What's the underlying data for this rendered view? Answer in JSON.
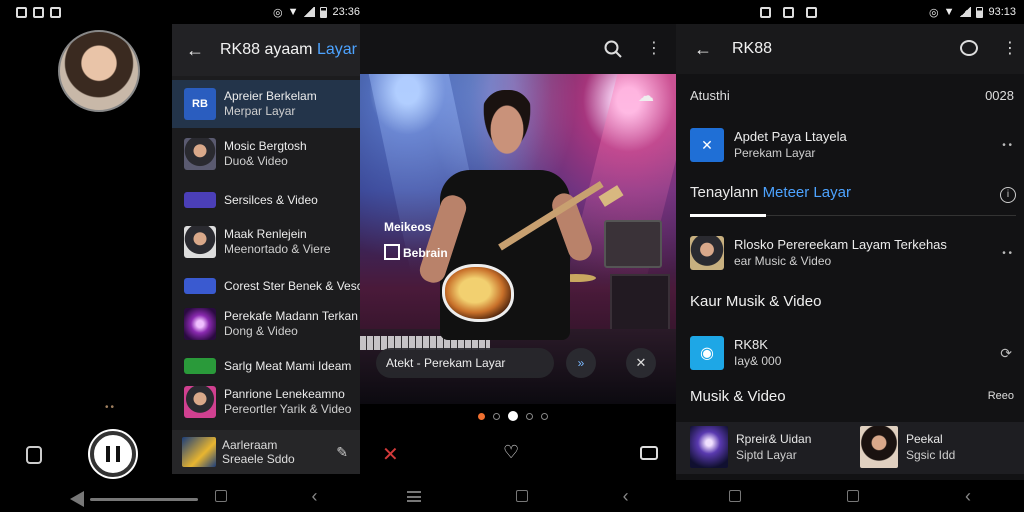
{
  "status_left": {
    "time": ""
  },
  "status_mid": {
    "time": "23:36"
  },
  "status_right": {
    "time": "93:13"
  },
  "menu": {
    "title_main": "RK88 ayaam",
    "title_accent": "Layar",
    "items": [
      {
        "line1": "Apreier Berkelam",
        "line2": "Merpar Layar"
      },
      {
        "line1": "Mosic Bergtosh",
        "line2": "Duo& Video"
      },
      {
        "line1": "Sersilces & Video",
        "line2": ""
      },
      {
        "line1": "Maak Renlejein",
        "line2": "Meenortado & Viere"
      },
      {
        "line1": "Corest Ster Benek & Veso",
        "line2": ""
      },
      {
        "line1": "Perekafe Madann Terkan",
        "line2": "Dong & Video"
      },
      {
        "line1": "Sarlg Meat Mami Ideam",
        "line2": ""
      },
      {
        "line1": "Panrione Lenekeamno",
        "line2": "Pereortler Yarik & Video"
      }
    ],
    "bottom": {
      "line1": "Aarleraam",
      "line2": "Sreaele Sddo"
    }
  },
  "player": {
    "overlay_line1": "Meikeos",
    "overlay_line2": "Bebrain",
    "toast_text": "Atekt - Perekam Layar",
    "toast_forward": "»",
    "toast_close": "✕"
  },
  "right": {
    "header_title": "RK88",
    "section_top_left": "Atusthi",
    "section_top_right": "0028",
    "row1": {
      "line1": "Apdet Paya Ltayela",
      "line2": "Perekam Layar",
      "meta": "• •"
    },
    "tab_active_white": "Tenaylann",
    "tab_active_blue": "Meteer Layar",
    "row2": {
      "line1": "Rlosko Perereekam Layam Terkehas",
      "line2": "ear Music & Video",
      "meta": "• •"
    },
    "section_music_video": "Kaur Musik & Video",
    "row3": {
      "line1": "RK8K",
      "line2": "Iay& 000"
    },
    "section_musik": "Musik & Video",
    "section_musik_meta": "Reeo",
    "card1": {
      "line1": "Rpreir& Uidan",
      "line2": "Siptd Layar"
    },
    "card2": {
      "line1": "Peekal",
      "line2": "Sgsic Idd"
    }
  },
  "colors": {
    "accent": "#4da3ff",
    "active_row": "#23344a",
    "red": "#d23a3a"
  },
  "icons": [
    "search-icon",
    "more-icon",
    "back-icon",
    "pause-icon",
    "share-icon",
    "heart-icon",
    "camera-icon",
    "close-icon",
    "chat-icon",
    "info-icon"
  ]
}
